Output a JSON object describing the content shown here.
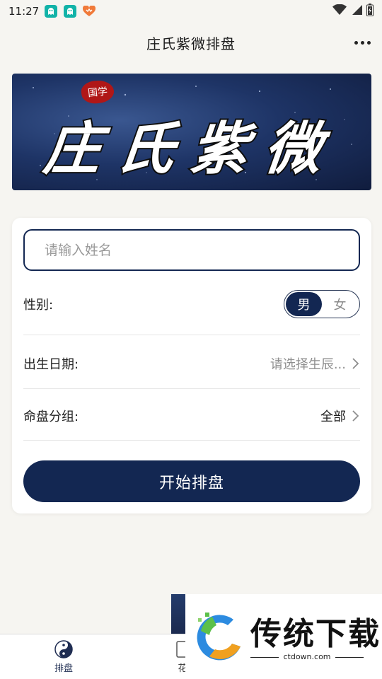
{
  "status_bar": {
    "time": "11:27",
    "apps": [
      {
        "icon": "app-ghost-icon",
        "color": "#12b3a8"
      },
      {
        "icon": "app-ghost-icon",
        "color": "#12b3a8"
      },
      {
        "icon": "heart-app-icon",
        "color": "#f07a3a"
      }
    ],
    "icons": [
      "wifi-icon",
      "signal-icon",
      "battery-icon"
    ]
  },
  "header": {
    "title": "庄氏紫微排盘",
    "more_icon": "more-dots-icon"
  },
  "banner": {
    "stamp_text": "国学",
    "title": "庄氏紫微",
    "colors": {
      "sky": "#1e3466",
      "stamp": "#b01717"
    }
  },
  "form": {
    "name_placeholder": "请输入姓名",
    "name_value": "",
    "gender_label": "性别:",
    "gender_options": [
      "男",
      "女"
    ],
    "gender_selected": "男",
    "birth_label": "出生日期:",
    "birth_value": "请选择生辰...",
    "group_label": "命盘分组:",
    "group_value": "全部",
    "submit_label": "开始排盘"
  },
  "tab_bar": {
    "tabs": [
      {
        "label": "排盘",
        "icon": "yin-yang-icon",
        "active": true
      },
      {
        "label": "花",
        "icon": "book-icon",
        "active": false
      }
    ]
  },
  "watermark": {
    "brand": "传统下载",
    "url": "ctdown.com"
  },
  "colors": {
    "primary": "#132752",
    "background": "#f6f5f1",
    "card": "#ffffff",
    "muted_text": "#8e8e8e"
  }
}
